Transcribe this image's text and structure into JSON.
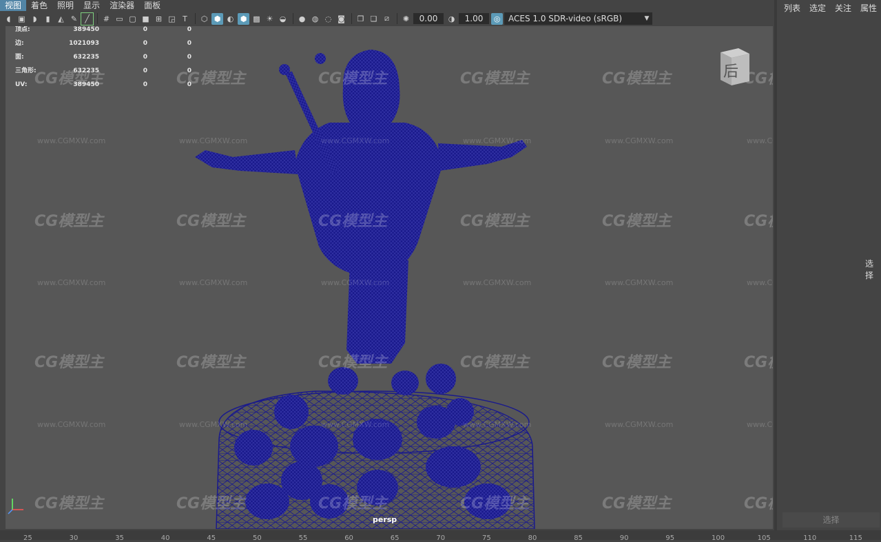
{
  "menu": [
    "视图",
    "着色",
    "照明",
    "显示",
    "渲染器",
    "面板"
  ],
  "toolbar": {
    "exposure": "0.00",
    "gamma": "1.00",
    "color_space": "ACES 1.0 SDR-video (sRGB)"
  },
  "hud": {
    "rows": [
      {
        "label": "顶点:",
        "v1": "389450",
        "v2": "0",
        "v3": "0"
      },
      {
        "label": "边:",
        "v1": "1021093",
        "v2": "0",
        "v3": "0"
      },
      {
        "label": "面:",
        "v1": "632235",
        "v2": "0",
        "v3": "0"
      },
      {
        "label": "三角形:",
        "v1": "632235",
        "v2": "0",
        "v3": "0"
      },
      {
        "label": "UV:",
        "v1": "389450",
        "v2": "0",
        "v3": "0"
      }
    ]
  },
  "viewcube_label": "后",
  "camera_label": "persp",
  "watermark": {
    "logo": "CG模型主",
    "url": "www.CGMXW.com"
  },
  "right_panel": {
    "tabs": [
      "列表",
      "选定",
      "关注",
      "属性"
    ],
    "select_label": "选择",
    "bottom_label": "选择"
  },
  "timeline_ticks": [
    "25",
    "30",
    "35",
    "40",
    "45",
    "50",
    "55",
    "60",
    "65",
    "70",
    "75",
    "80",
    "85",
    "90",
    "95",
    "100",
    "105",
    "110",
    "115"
  ],
  "colors": {
    "wireframe": "#1a1a8c",
    "viewport_bg": "#575757",
    "highlight": "#5285a6"
  }
}
